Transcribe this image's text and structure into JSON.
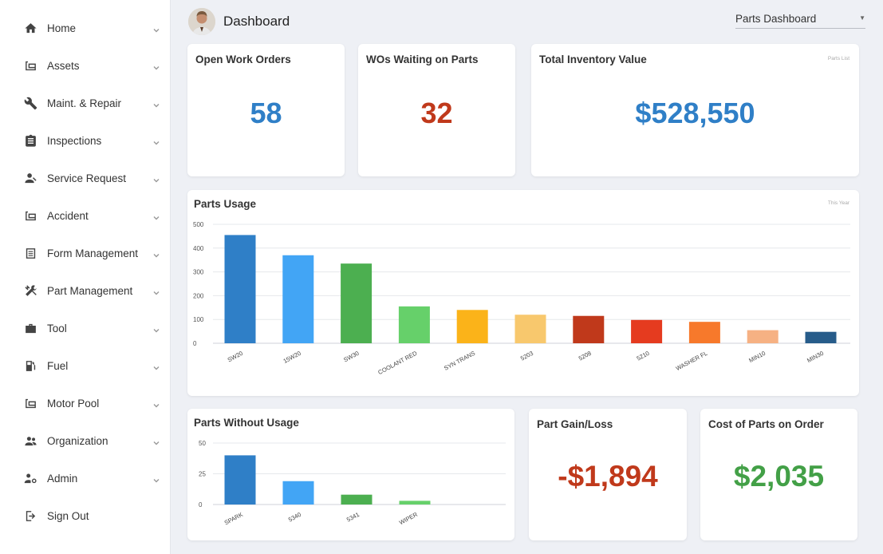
{
  "sidebar": {
    "items": [
      {
        "label": "Home",
        "icon": "home-icon"
      },
      {
        "label": "Assets",
        "icon": "assets-icon"
      },
      {
        "label": "Maint. & Repair",
        "icon": "wrench-icon"
      },
      {
        "label": "Inspections",
        "icon": "clipboard-icon"
      },
      {
        "label": "Service Request",
        "icon": "service-request-icon"
      },
      {
        "label": "Accident",
        "icon": "accident-icon"
      },
      {
        "label": "Form Management",
        "icon": "form-icon"
      },
      {
        "label": "Part Management",
        "icon": "tools-icon"
      },
      {
        "label": "Tool",
        "icon": "toolbox-icon"
      },
      {
        "label": "Fuel",
        "icon": "fuel-icon"
      },
      {
        "label": "Motor Pool",
        "icon": "motor-pool-icon"
      },
      {
        "label": "Organization",
        "icon": "organization-icon"
      },
      {
        "label": "Admin",
        "icon": "admin-icon"
      },
      {
        "label": "Sign Out",
        "icon": "sign-out-icon"
      }
    ]
  },
  "header": {
    "title": "Dashboard",
    "dashboard_select": "Parts Dashboard"
  },
  "cards": {
    "open_work_orders": {
      "title": "Open Work Orders",
      "value": "58"
    },
    "wos_waiting": {
      "title": "WOs Waiting on Parts",
      "value": "32"
    },
    "inventory_value": {
      "title": "Total Inventory Value",
      "tag": "Parts List",
      "value": "$528,550"
    },
    "parts_usage": {
      "title": "Parts Usage",
      "tag": "This Year"
    },
    "parts_without_usage": {
      "title": "Parts Without Usage"
    },
    "gain_loss": {
      "title": "Part Gain/Loss",
      "value": "-$1,894"
    },
    "cost_on_order": {
      "title": "Cost of Parts on Order",
      "value": "$2,035"
    }
  },
  "colors": {
    "blue": "#2f7fc7",
    "red": "#c0391b",
    "green": "#43a047"
  },
  "chart_data": [
    {
      "type": "bar",
      "title": "Parts Usage",
      "categories": [
        "SW20",
        "15W20",
        "SW30",
        "COOLANT RED",
        "SYN TRANS",
        "5203",
        "5208",
        "5210",
        "WASHER FL",
        "MIN10",
        "MIN30"
      ],
      "values": [
        455,
        370,
        335,
        155,
        140,
        120,
        115,
        98,
        90,
        55,
        48
      ],
      "colors": [
        "#2f7fc7",
        "#42a5f5",
        "#4caf50",
        "#66d06a",
        "#fbb319",
        "#f8c86d",
        "#c0391b",
        "#e53b1f",
        "#f7792b",
        "#f6b183",
        "#275c8a"
      ],
      "ylim": [
        0,
        500
      ],
      "yticks": [
        0,
        100,
        200,
        300,
        400,
        500
      ],
      "grid": true
    },
    {
      "type": "bar",
      "title": "Parts Without Usage",
      "categories": [
        "SPARK",
        "5340",
        "5341",
        "WIPER"
      ],
      "values": [
        40,
        19,
        8,
        3
      ],
      "colors": [
        "#2f7fc7",
        "#42a5f5",
        "#4caf50",
        "#66d06a"
      ],
      "ylim": [
        0,
        50
      ],
      "yticks": [
        0,
        25,
        50
      ],
      "grid": true
    }
  ]
}
